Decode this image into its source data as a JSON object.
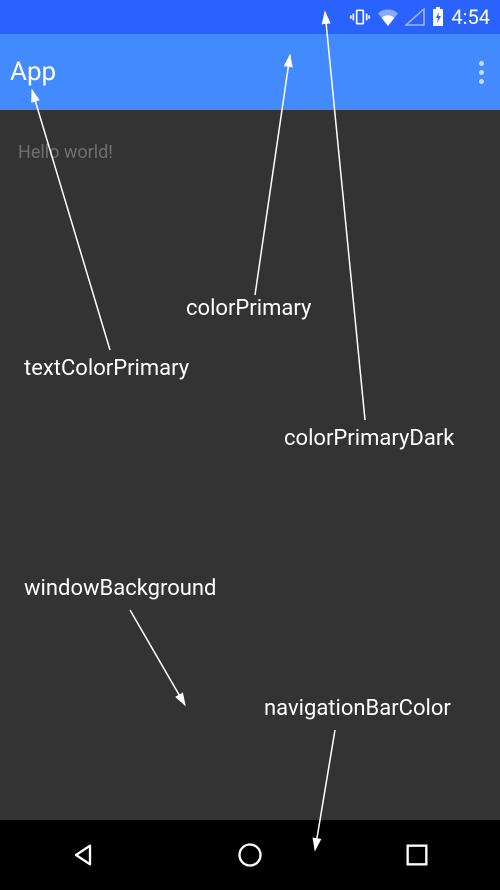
{
  "status_bar": {
    "time": "4:54"
  },
  "app_bar": {
    "title": "App"
  },
  "content": {
    "hello_text": "Hello world!"
  },
  "annotations": {
    "colorPrimary": "colorPrimary",
    "textColorPrimary": "textColorPrimary",
    "colorPrimaryDark": "colorPrimaryDark",
    "windowBackground": "windowBackground",
    "navigationBarColor": "navigationBarColor"
  },
  "colors": {
    "colorPrimary": "#448aff",
    "colorPrimaryDark": "#2962ff",
    "windowBackground": "#333333",
    "navigationBarColor": "#000000",
    "textColorPrimary": "#ffffff"
  }
}
